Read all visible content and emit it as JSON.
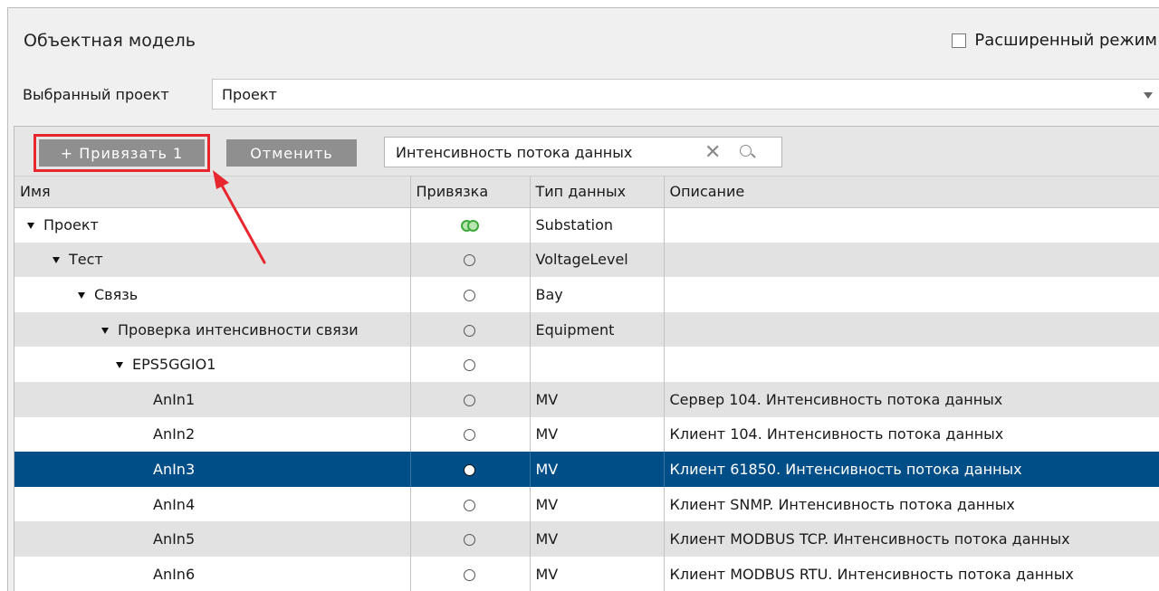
{
  "panel": {
    "title": "Объектная модель",
    "advanced_label": "Расширенный режим",
    "project_label": "Выбранный проект",
    "project_value": "Проект"
  },
  "toolbar": {
    "bind_label": "+ Привязать 1",
    "cancel_label": "Отменить",
    "search_value": "Интенсивность потока данных"
  },
  "table": {
    "headers": [
      "Имя",
      "Привязка",
      "Тип данных",
      "Описание"
    ],
    "rows": [
      {
        "name": "Проект",
        "type": "Substation",
        "description": ""
      },
      {
        "name": "Тест",
        "type": "VoltageLevel",
        "description": ""
      },
      {
        "name": "Связь",
        "type": "Bay",
        "description": ""
      },
      {
        "name": "Проверка интенсивности связи",
        "type": "Equipment",
        "description": ""
      },
      {
        "name": "EPS5GGIO1",
        "type": "",
        "description": ""
      },
      {
        "name": "AnIn1",
        "type": "MV",
        "description": "Сервер 104. Интенсивность потока данных"
      },
      {
        "name": "AnIn2",
        "type": "MV",
        "description": "Клиент 104. Интенсивность потока данных"
      },
      {
        "name": "AnIn3",
        "type": "MV",
        "description": "Клиент 61850. Интенсивность потока данных"
      },
      {
        "name": "AnIn4",
        "type": "MV",
        "description": "Клиент SNMP. Интенсивность потока данных"
      },
      {
        "name": "AnIn5",
        "type": "MV",
        "description": "Клиент MODBUS TCP. Интенсивность потока данных"
      },
      {
        "name": "AnIn6",
        "type": "MV",
        "description": "Клиент MODBUS RTU. Интенсивность потока данных"
      }
    ]
  },
  "colors": {
    "selected_row": "#004e88",
    "highlight": "#e8262d",
    "bound_icon": "#3eaa3c"
  },
  "icons": {
    "search": "search-icon",
    "clear": "clear-icon",
    "expand": "expand-triangle-icon",
    "binding_partial": "double-circle-icon",
    "binding_none": "empty-circle-icon"
  }
}
